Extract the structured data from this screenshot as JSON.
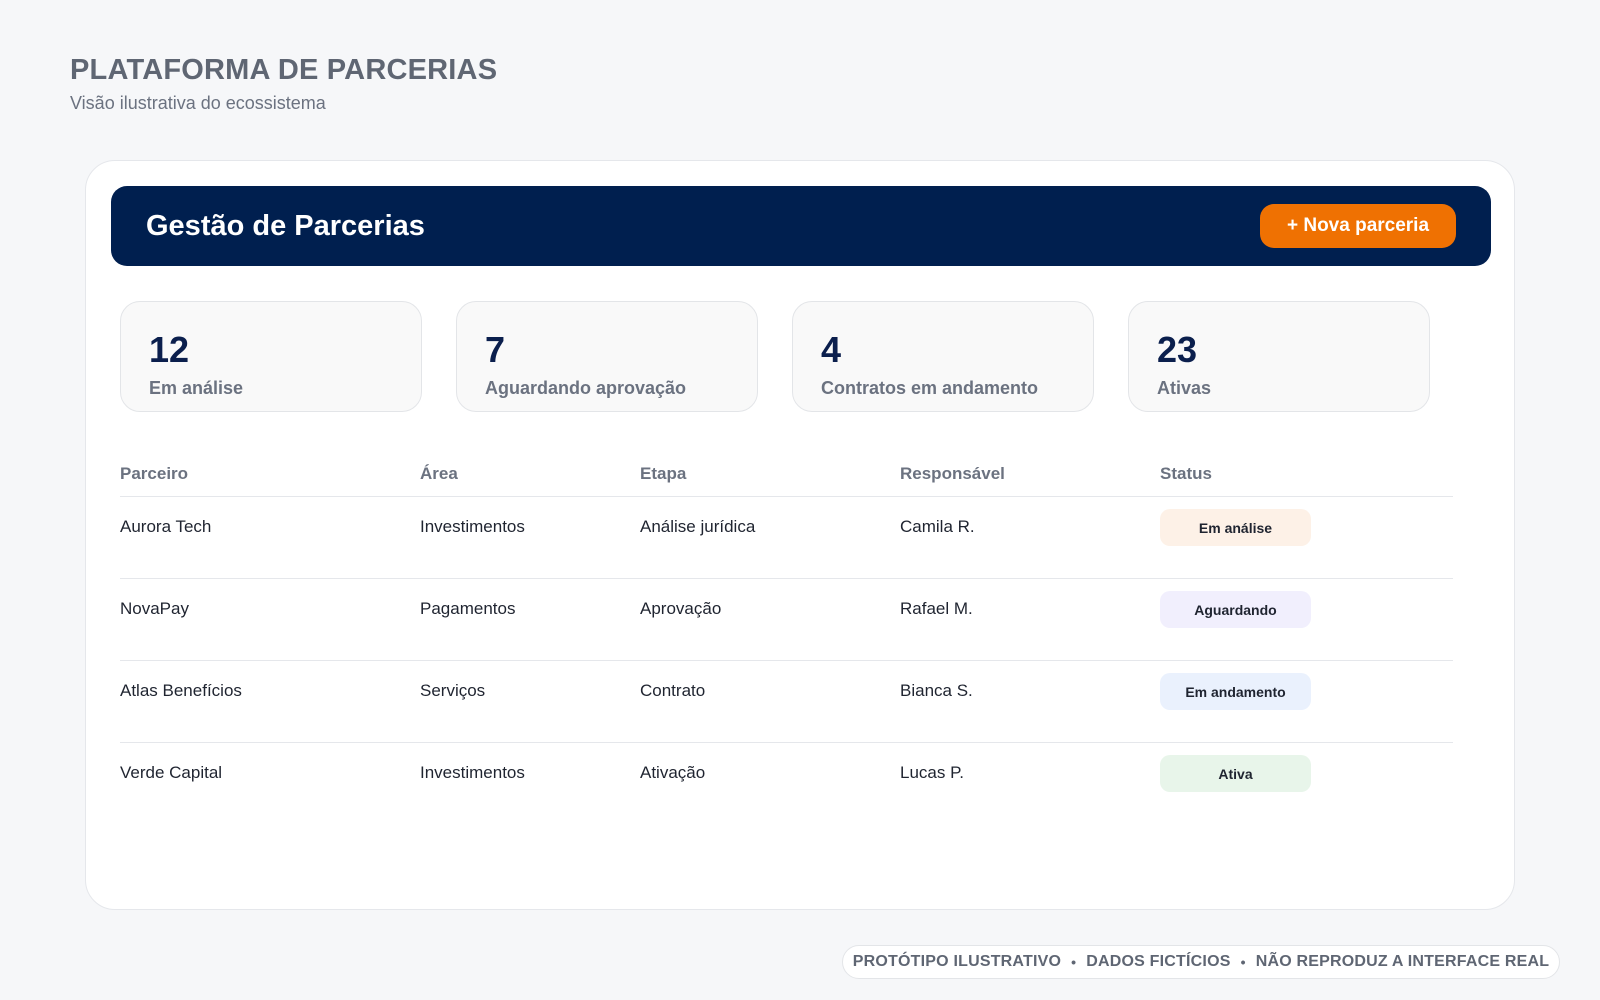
{
  "header": {
    "title": "PLATAFORMA DE PARCERIAS",
    "subtitle": "Visão ilustrativa do ecossistema"
  },
  "banner": {
    "title": "Gestão de Parcerias",
    "new_button": "+ Nova parceria"
  },
  "stats": [
    {
      "value": "12",
      "label": "Em análise"
    },
    {
      "value": "7",
      "label": "Aguardando aprovação"
    },
    {
      "value": "4",
      "label": "Contratos em andamento"
    },
    {
      "value": "23",
      "label": "Ativas"
    }
  ],
  "table": {
    "columns": [
      "Parceiro",
      "Área",
      "Etapa",
      "Responsável",
      "Status"
    ],
    "rows": [
      {
        "partner": "Aurora Tech",
        "area": "Investimentos",
        "stage": "Análise jurídica",
        "owner": "Camila R.",
        "status": "Em análise",
        "status_color": "#fdf1e7"
      },
      {
        "partner": "NovaPay",
        "area": "Pagamentos",
        "stage": "Aprovação",
        "owner": "Rafael M.",
        "status": "Aguardando",
        "status_color": "#f1effd"
      },
      {
        "partner": "Atlas Benefícios",
        "area": "Serviços",
        "stage": "Contrato",
        "owner": "Bianca S.",
        "status": "Em andamento",
        "status_color": "#eaf1fd"
      },
      {
        "partner": "Verde Capital",
        "area": "Investimentos",
        "stage": "Ativação",
        "owner": "Lucas P.",
        "status": "Ativa",
        "status_color": "#e8f5ea"
      }
    ]
  },
  "footer": {
    "items": [
      "PROTÓTIPO ILUSTRATIVO",
      "DADOS FICTÍCIOS",
      "NÃO REPRODUZ A INTERFACE REAL"
    ],
    "separator": "•"
  },
  "colors": {
    "banner": "#001f4f",
    "accent": "#ef7102",
    "stat_value": "#0b1f4d"
  }
}
